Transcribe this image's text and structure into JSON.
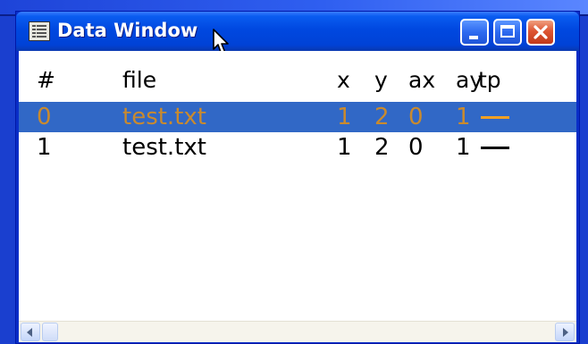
{
  "window": {
    "title": "Data Window",
    "icon": "data-grid-icon",
    "controls": [
      "minimize-icon",
      "maximize-icon",
      "close-icon"
    ],
    "close_glyph": "✕"
  },
  "table": {
    "headers": {
      "num": "#",
      "file": "file",
      "x": "x",
      "y": "y",
      "ax": "ax",
      "ay": "ay",
      "tp": "tp"
    },
    "rows": [
      {
        "num": "0",
        "file": "test.txt",
        "x": "1",
        "y": "2",
        "ax": "0",
        "ay": "1",
        "tp_color": "#f2a024",
        "selected": true
      },
      {
        "num": "1",
        "file": "test.txt",
        "x": "1",
        "y": "2",
        "ax": "0",
        "ay": "1",
        "tp_color": "#000000",
        "selected": false
      }
    ]
  },
  "colors": {
    "selection": "#3168c6",
    "selected_text": "#c98a2e",
    "titlebar": "#0048e0",
    "close_button": "#dd5533"
  }
}
